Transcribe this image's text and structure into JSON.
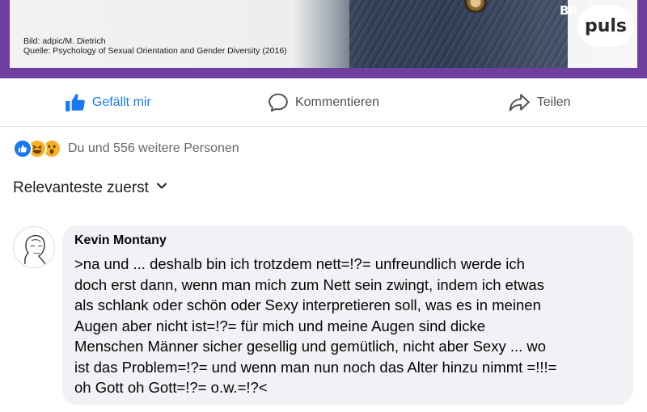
{
  "post_image": {
    "credit_line_1": "Bild: adpic/M. Dietrich",
    "credit_line_2": "Quelle: Psychology of Sexual Orientation and Gender Diversity (2016)",
    "logo_br": "BR",
    "logo_puls": "puls",
    "frame_color": "#6f3fa0"
  },
  "actions": {
    "like_label": "Gefällt mir",
    "comment_label": "Kommentieren",
    "share_label": "Teilen",
    "like_color": "#1877f2"
  },
  "reactions": {
    "icons": [
      "like-icon",
      "haha-icon",
      "wow-icon"
    ],
    "summary": "Du und 556 weitere Personen"
  },
  "sort": {
    "label": "Relevanteste zuerst"
  },
  "comment": {
    "author": "Kevin Montany",
    "text": ">na und ... deshalb bin ich trotzdem nett=!?= unfreundlich werde ich\ndoch erst dann, wenn man mich zum Nett sein zwingt, indem ich etwas\nals schlank oder schön oder Sexy  interpretieren soll, was es in meinen\nAugen aber nicht ist=!?= für mich und meine Augen sind dicke\nMenschen Männer sicher gesellig und gemütlich, nicht aber Sexy ... wo\nist das Problem=!?= und wenn man nun noch das Alter hinzu nimmt =!!!=\noh Gott oh Gott=!?= o.w.=!?<"
  }
}
